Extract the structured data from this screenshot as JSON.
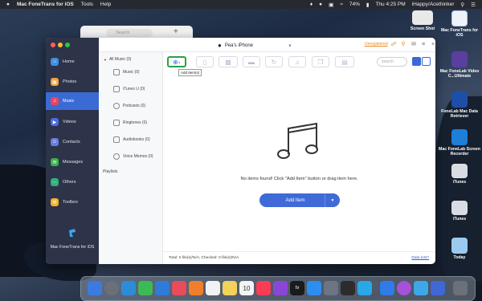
{
  "menubar": {
    "apple": "",
    "app": "Mac FoneTrans for iOS",
    "tools": "Tools",
    "help": "Help",
    "battery": "74%",
    "time": "Thu 4:25 PM",
    "user": "iHappy/Acethinker"
  },
  "bg_window": {
    "search_placeholder": "Search",
    "plus": "+"
  },
  "app": {
    "device_name": "Pea's iPhone",
    "unregistered": "Unregistered",
    "sidebar": [
      {
        "label": "Home",
        "color": "#3f8ee6"
      },
      {
        "label": "Photos",
        "color": "#f2a33a"
      },
      {
        "label": "Music",
        "color": "#e8455c"
      },
      {
        "label": "Videos",
        "color": "#4b6de0"
      },
      {
        "label": "Contacts",
        "color": "#6b7ce0"
      },
      {
        "label": "Messages",
        "color": "#39b44a"
      },
      {
        "label": "Others",
        "color": "#2fb27a"
      },
      {
        "label": "Toolbox",
        "color": "#f2b52e"
      }
    ],
    "brand": "Mac FoneTrans for iOS",
    "categories": {
      "all": "All Music (0)",
      "items": [
        "Music (0)",
        "iTunes U (0)",
        "Podcasts (0)",
        "Ringtones (0)",
        "Audiobooks (0)",
        "Voice Memos (0)"
      ],
      "playlists": "Playlists"
    },
    "toolbar": {
      "tooltip": "Add Item(s)",
      "search_placeholder": "search"
    },
    "empty_message": "No items found! Click \"Add Item\" button or drag item here.",
    "add_button": "Add Item",
    "status": "Total: 0 file(s)/N/A; Checked: 0 file(s)/N/A",
    "data_lost": "Data lost?"
  },
  "desktop_icons": [
    {
      "label": "Screen Shot",
      "color": "#ddd"
    },
    {
      "label": "Mac FoneTrans for iOS",
      "color": "#eef3fb"
    },
    {
      "label": "Mac FoneLab Video C...Ultimate",
      "color": "#5a3fa0"
    },
    {
      "label": "FoneLab Mac Data Retriever",
      "color": "#1d4fa8"
    },
    {
      "label": "Mac FoneLab Screen Recorder",
      "color": "#1d7fd8"
    },
    {
      "label": "iTunes",
      "color": "#d9dde3"
    },
    {
      "label": "iTunes",
      "color": "#d9dde3"
    },
    {
      "label": "Today",
      "color": "#9bc9f0"
    }
  ],
  "dock_colors": [
    "#3b7be0",
    "#6b6f7a",
    "#2e8bd6",
    "#3cba54",
    "#2f7bd9",
    "#e84b5a",
    "#f07e2a",
    "#f2f2f2",
    "#f3d15a",
    "#f4f4f4",
    "#fc3c54",
    "#8a46d8",
    "#1b1b1b",
    "#2b8ef0",
    "#6d7583",
    "#2c2c2c",
    "#2aa7e6",
    "#2f7be8",
    "#a651d8",
    "#3da8e8",
    "#3f68d6",
    "#6c7078"
  ],
  "calendar": {
    "day": "10"
  },
  "tv_label": "tv"
}
